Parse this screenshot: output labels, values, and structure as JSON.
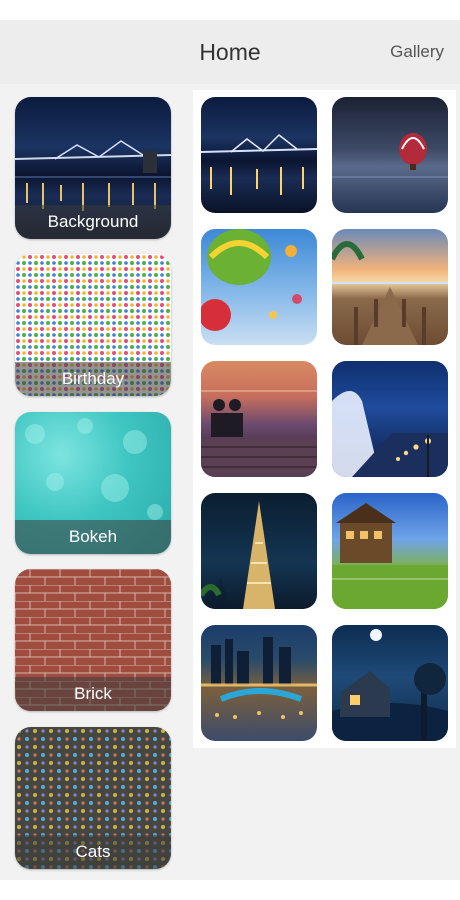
{
  "header": {
    "title": "Home",
    "gallery_label": "Gallery"
  },
  "categories": [
    {
      "label": "Background"
    },
    {
      "label": "Birthday"
    },
    {
      "label": "Bokeh"
    },
    {
      "label": "Brick"
    },
    {
      "label": "Cats"
    }
  ]
}
